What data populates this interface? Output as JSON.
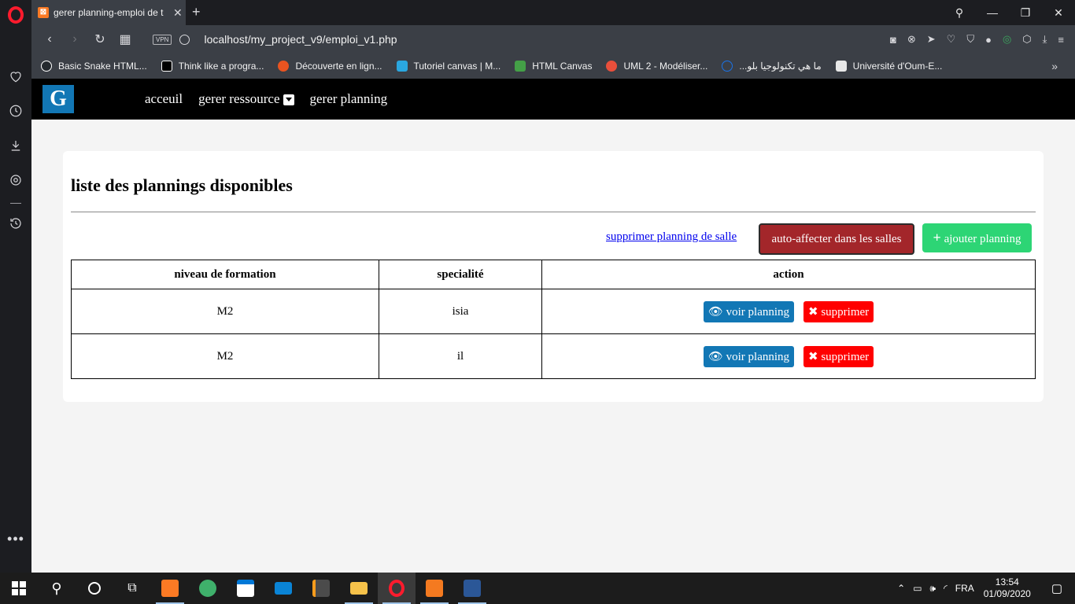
{
  "browser": {
    "tab_title": "gerer planning-emploi de t",
    "url": "localhost/my_project_v9/emploi_v1.php",
    "vpn": "VPN",
    "bookmarks": [
      "Basic Snake HTML...",
      "Think like a progra...",
      "Découverte en lign...",
      "Tutoriel canvas | M...",
      "HTML Canvas",
      "UML 2 - Modéliser...",
      "ما هي تكنولوجيا بلو...",
      "Université d'Oum-E..."
    ],
    "bookmark_colors": [
      "#24292e",
      "#1b1f23",
      "#e95420",
      "#2aa7e0",
      "#44a047",
      "#e94f3b",
      "#1a73e8",
      "#e8e8e8"
    ]
  },
  "nav": {
    "logo": "G",
    "items": [
      "acceuil",
      "gerer ressource",
      "gerer planning"
    ]
  },
  "content": {
    "title": "liste des plannings disponibles",
    "delete_link": "supprimer planning de salle",
    "auto_button": "auto-affecter dans les salles",
    "add_button": "ajouter planning",
    "add_icon": "+",
    "table": {
      "headers": [
        "niveau de formation",
        "specialité",
        "action"
      ],
      "rows": [
        {
          "niveau": "M2",
          "specialite": "isia"
        },
        {
          "niveau": "M2",
          "specialite": "il"
        }
      ],
      "view_label": "voir planning",
      "delete_label": "supprimer",
      "view_icon": "👁",
      "delete_icon": "✖"
    }
  },
  "taskbar": {
    "time": "13:54",
    "date": "01/09/2020",
    "lang": "FRA"
  }
}
